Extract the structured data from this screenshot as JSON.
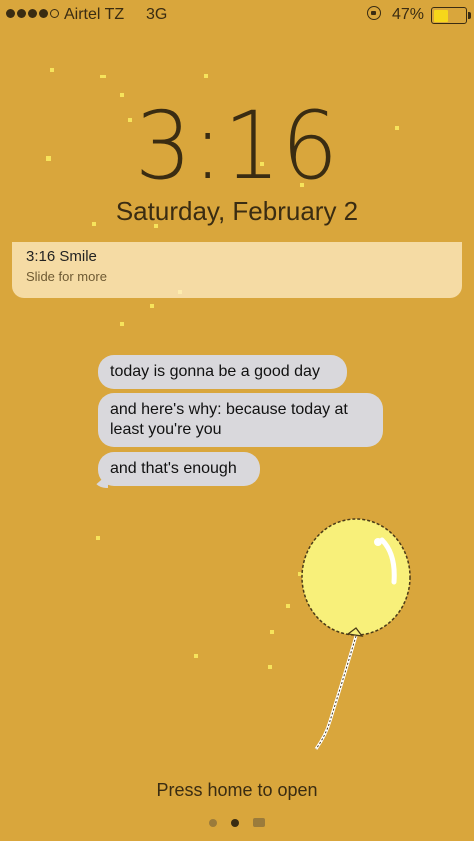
{
  "status_bar": {
    "carrier": "Airtel TZ",
    "network": "3G",
    "battery_percent": "47%",
    "battery_level": 0.47,
    "signal_bars_filled": 4,
    "signal_bars_total": 5
  },
  "lock_screen": {
    "time": "3:16",
    "date": "Saturday, February 2",
    "press_home": "Press home to open"
  },
  "notification": {
    "title": "3:16 Smile",
    "subtitle": "Slide for more"
  },
  "messages": [
    "today is gonna be a good day",
    "and here's why: because today at least you're you",
    "and that's enough"
  ],
  "pager": {
    "pages": 2,
    "active_index": 1,
    "has_camera": true
  },
  "colors": {
    "background": "#d9a63c",
    "bubble": "#d9d8dc",
    "balloon": "#f8f07a",
    "battery_fill": "#f6d71a"
  },
  "icons": [
    "lock-rotation-icon",
    "battery-icon",
    "camera-icon",
    "balloon-icon"
  ]
}
